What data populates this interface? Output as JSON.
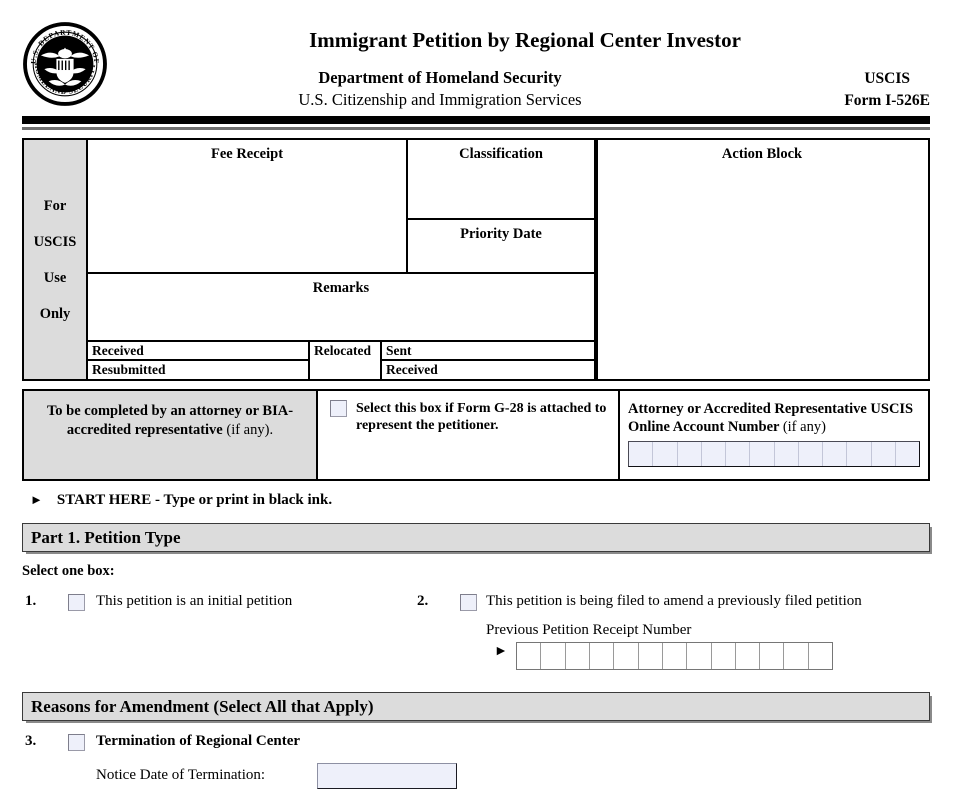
{
  "header": {
    "title": "Immigrant Petition by Regional Center Investor",
    "agency_line1": "Department of Homeland Security",
    "agency_line2": "U.S. Citizenship and Immigration Services",
    "right_line1": "USCIS",
    "right_line2": "Form I-526E",
    "seal_icon": "dhs-seal-icon",
    "seal_top_text": "U.S. DEPARTMENT OF",
    "seal_bottom_text": "HOMELAND SECURITY"
  },
  "uscis_use_only": {
    "side_label": "For USCIS Use Only",
    "side_label_lines": [
      "For",
      "USCIS",
      "Use",
      "Only"
    ],
    "fee_receipt": "Fee Receipt",
    "classification": "Classification",
    "priority_date": "Priority Date",
    "action_block": "Action Block",
    "remarks": "Remarks",
    "received": "Received",
    "relocated": "Relocated",
    "sent": "Sent",
    "resubmitted": "Resubmitted",
    "received2": "Received"
  },
  "attorney": {
    "left_bold": "To be completed by an attorney or BIA-accredited representative",
    "left_plain": "(if any).",
    "g28_checkbox_label": "Select this box if Form G-28 is attached to represent the petitioner.",
    "g28_checked": false,
    "account_label_bold": "Attorney or Accredited Representative USCIS Online Account Number",
    "account_label_plain": "(if any)",
    "account_cells": 12,
    "account_value": ""
  },
  "start_here": {
    "arrow_icon": "right-triangle-icon",
    "text": "START HERE - Type or print in black ink."
  },
  "part1": {
    "heading": "Part 1.  Petition Type",
    "instruction": "Select one box:",
    "items": [
      {
        "number": "1.",
        "label": "This petition is an initial petition",
        "checked": false
      },
      {
        "number": "2.",
        "label": "This petition is being filed to amend a previously filed petition",
        "checked": false
      }
    ],
    "previous_receipt": {
      "label": "Previous Petition Receipt Number",
      "arrow_icon": "right-triangle-icon",
      "cells": 13,
      "value": ""
    }
  },
  "reasons_for_amendment": {
    "heading": "Reasons for Amendment (Select All that Apply)",
    "items": [
      {
        "number": "3.",
        "label": "Termination of Regional Center",
        "checked": false,
        "sub_label": "Notice Date of Termination:",
        "sub_value": ""
      }
    ]
  },
  "colors": {
    "shade_gray": "#dcdcdc",
    "field_fill": "#eef0fa",
    "rule_black": "#000000",
    "rule_gray": "#6e6e6e"
  }
}
